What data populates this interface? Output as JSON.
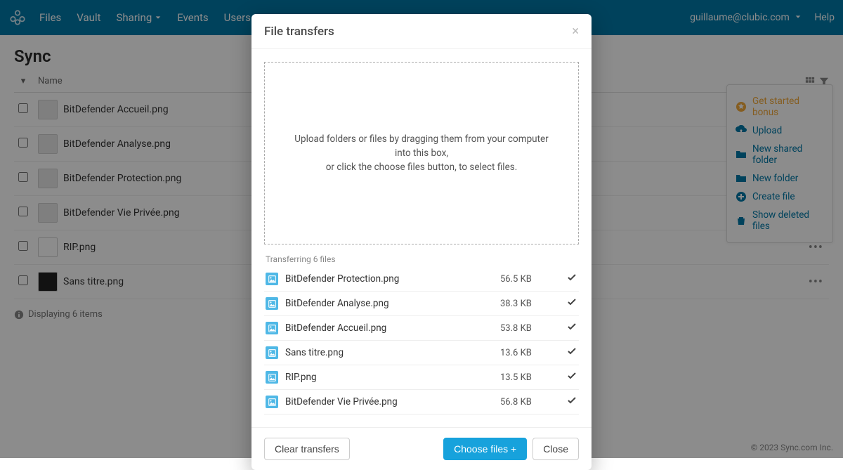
{
  "topbar": {
    "nav": {
      "files": "Files",
      "vault": "Vault",
      "sharing": "Sharing",
      "events": "Events",
      "users": "Users"
    },
    "email": "guillaume@clubic.com",
    "help": "Help"
  },
  "page_title": "Sync",
  "table": {
    "name_header": "Name",
    "rows": [
      {
        "name": "BitDefender Accueil.png"
      },
      {
        "name": "BitDefender Analyse.png"
      },
      {
        "name": "BitDefender Protection.png"
      },
      {
        "name": "BitDefender Vie Privée.png"
      },
      {
        "name": "RIP.png"
      },
      {
        "name": "Sans titre.png"
      }
    ]
  },
  "footer_info": "Displaying 6 items",
  "copyright": "© 2023 Sync.com Inc.",
  "side_panel": {
    "bonus": "Get started bonus",
    "upload": "Upload",
    "new_shared": "New shared folder",
    "new_folder": "New folder",
    "create_file": "Create file",
    "show_deleted": "Show deleted files"
  },
  "modal": {
    "title": "File transfers",
    "dropzone_line1": "Upload folders or files by dragging them from your computer into this box,",
    "dropzone_line2": "or click the choose files button, to select files.",
    "transferring_label": "Transferring 6 files",
    "transfers": [
      {
        "name": "BitDefender Protection.png",
        "size": "56.5 KB"
      },
      {
        "name": "BitDefender Analyse.png",
        "size": "38.3 KB"
      },
      {
        "name": "BitDefender Accueil.png",
        "size": "53.8 KB"
      },
      {
        "name": "Sans titre.png",
        "size": "13.6 KB"
      },
      {
        "name": "RIP.png",
        "size": "13.5 KB"
      },
      {
        "name": "BitDefender Vie Privée.png",
        "size": "56.8 KB"
      }
    ],
    "clear": "Clear transfers",
    "choose": "Choose files +",
    "close": "Close"
  }
}
